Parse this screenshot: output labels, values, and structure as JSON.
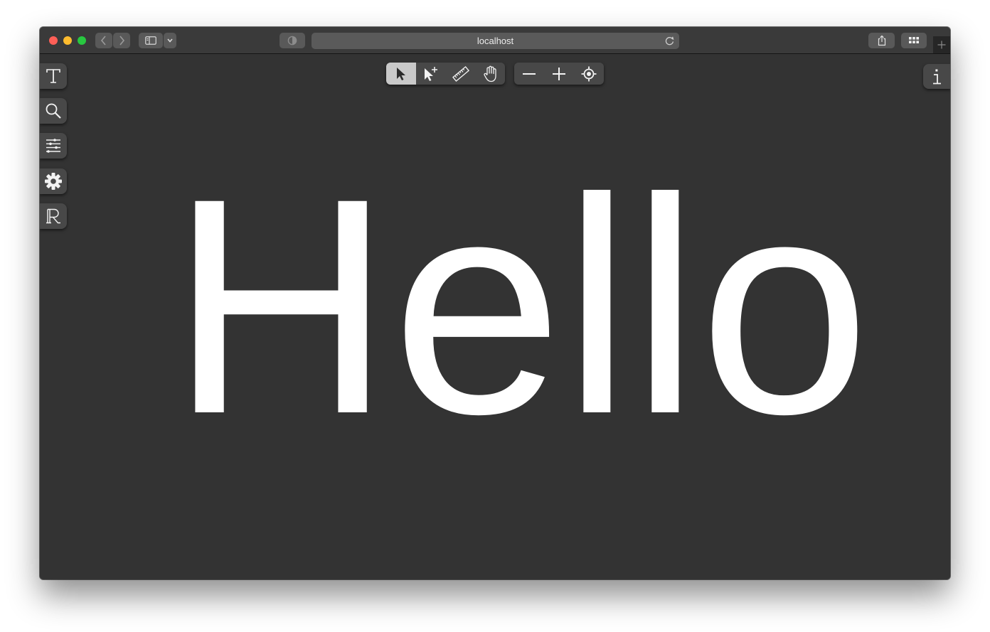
{
  "browser": {
    "url": "localhost",
    "icons": {
      "back": "chevron-left-icon",
      "forward": "chevron-right-icon",
      "sidebar": "sidebar-icon",
      "sidebar_menu": "chevron-down-icon",
      "privacy": "shield-icon",
      "reload": "reload-icon",
      "share": "share-icon",
      "tabs_overview": "grid-icon",
      "new_tab": "plus-icon"
    },
    "colors": {
      "close": "#ff5f57",
      "minimize": "#febc2e",
      "maximize": "#28c840"
    }
  },
  "sidebar": {
    "items": [
      {
        "name": "text",
        "icon": "text-t-icon"
      },
      {
        "name": "search",
        "icon": "magnifier-icon"
      },
      {
        "name": "settings-sliders",
        "icon": "sliders-icon"
      },
      {
        "name": "preferences",
        "icon": "gear-icon"
      },
      {
        "name": "r-symbol",
        "icon": "double-struck-r-icon"
      }
    ]
  },
  "toolbar": {
    "tools": [
      {
        "name": "select",
        "icon": "pointer-arrow-icon",
        "active": true
      },
      {
        "name": "add-point",
        "icon": "pointer-plus-icon",
        "active": false
      },
      {
        "name": "measure",
        "icon": "ruler-icon",
        "active": false
      },
      {
        "name": "pan",
        "icon": "hand-icon",
        "active": false
      }
    ],
    "zoom": [
      {
        "name": "zoom-out",
        "icon": "minus-icon"
      },
      {
        "name": "zoom-in",
        "icon": "plus-icon"
      },
      {
        "name": "center",
        "icon": "crosshair-icon"
      }
    ]
  },
  "info_button": {
    "icon": "info-icon"
  },
  "canvas": {
    "text": "Hello",
    "text_color": "#ffffff",
    "background": "#333333"
  }
}
